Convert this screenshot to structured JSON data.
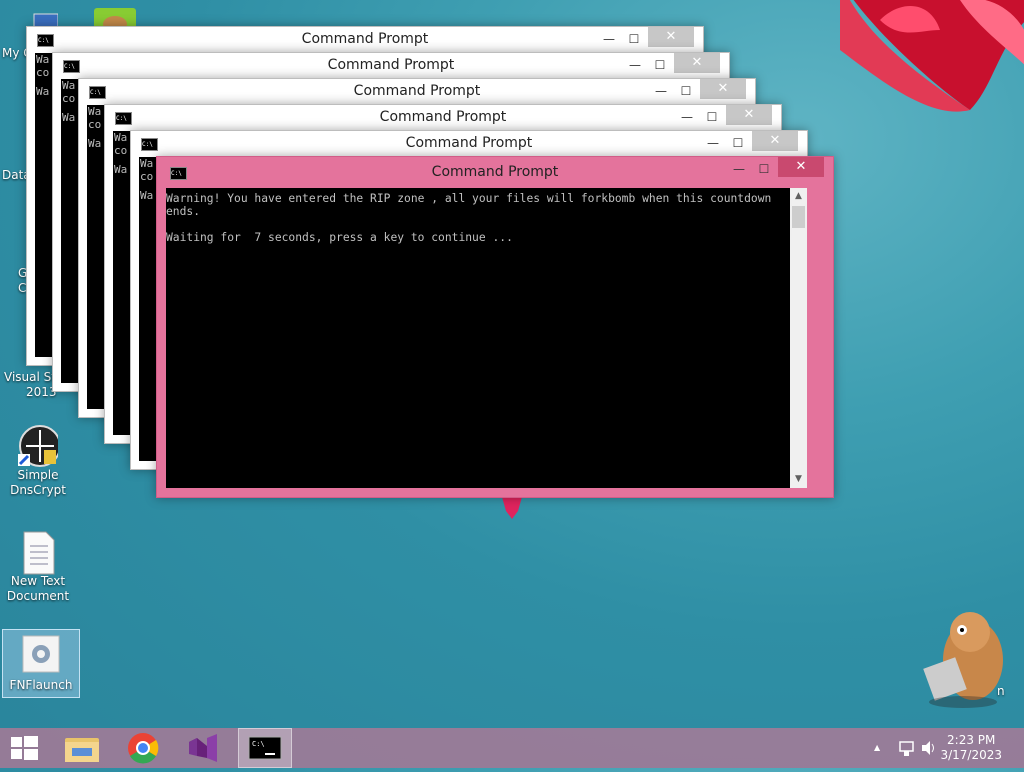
{
  "desktop": {
    "icons": [
      {
        "id": "my-computer",
        "label": "My C"
      },
      {
        "id": "data",
        "label": "Data"
      },
      {
        "id": "chrome",
        "label_line1": "G",
        "label_line2": "C"
      },
      {
        "id": "visual-studio",
        "label_line1": "Visual Stu",
        "label_line2": "2013"
      },
      {
        "id": "simple-dnscrypt",
        "label_line1": "Simple",
        "label_line2": "DnsCrypt"
      },
      {
        "id": "new-text-document",
        "label_line1": "New Text",
        "label_line2": "Document"
      },
      {
        "id": "fnflaunch",
        "label": "FNFlaunch"
      }
    ],
    "edge_label": "n"
  },
  "windows": {
    "background_title": "Command Prompt",
    "bg_console_line1": "Wa",
    "bg_console_line2": "co",
    "active": {
      "title": "Command Prompt",
      "console_text": "Warning! You have entered the RIP zone , all your files will forkbomb when this countdown ends.\n\nWaiting for  7 seconds, press a key to continue ..."
    },
    "min_glyph": "—",
    "max_glyph": "☐",
    "close_glyph": "✕"
  },
  "taskbar": {
    "clock_time": "2:23 PM",
    "clock_date": "3/17/2023",
    "apps": [
      "start-button",
      "file-explorer",
      "chrome",
      "visual-studio",
      "command-prompt"
    ]
  },
  "colors": {
    "active_frame": "#e4739c",
    "close_button": "#c9496f",
    "taskbar": "#b47896"
  }
}
